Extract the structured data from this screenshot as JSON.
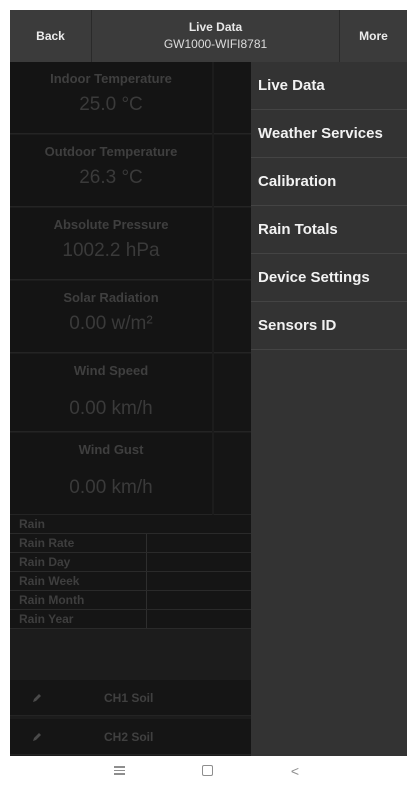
{
  "header": {
    "back_label": "Back",
    "title": "Live Data",
    "subtitle": "GW1000-WIFI8781",
    "more_label": "More"
  },
  "tiles": [
    {
      "label": "Indoor Temperature",
      "value": "25.0 °C"
    },
    {
      "label": "Outdoor Temperature",
      "value": "26.3 °C"
    },
    {
      "label": "Absolute Pressure",
      "value": "1002.2 hPa"
    },
    {
      "label": "Solar Radiation",
      "value": "0.00 w/m²"
    },
    {
      "label": "Wind Speed",
      "value": "0.00 km/h"
    },
    {
      "label": "Wind Gust",
      "value": "0.00 km/h"
    }
  ],
  "rain": {
    "header": "Rain",
    "rows": [
      "Rain Rate",
      "Rain Day",
      "Rain Week",
      "Rain Month",
      "Rain Year"
    ]
  },
  "soil": [
    {
      "icon": "pencil-icon",
      "label": "CH1 Soil"
    },
    {
      "icon": "pencil-icon",
      "label": "CH2 Soil"
    }
  ],
  "menu": {
    "items": [
      "Live Data",
      "Weather Services",
      "Calibration",
      "Rain Totals",
      "Device Settings",
      "Sensors ID"
    ]
  },
  "nav": {
    "recent_icon": "menu-lines-icon",
    "home_icon": "square-icon",
    "back_icon": "chevron-left-icon",
    "back_glyph": "<"
  }
}
